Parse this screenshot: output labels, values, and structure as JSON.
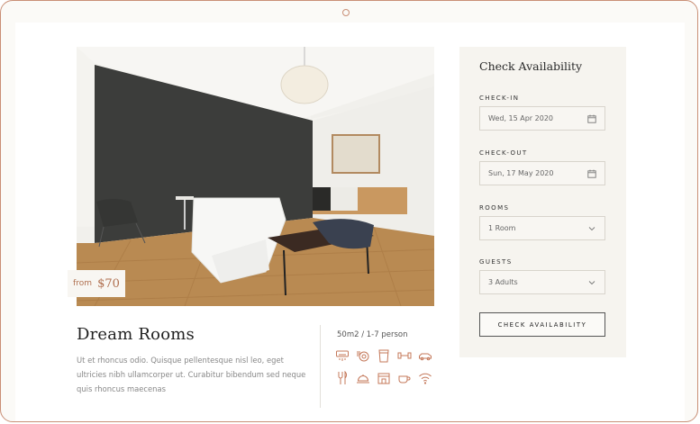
{
  "room": {
    "price_prefix": "from",
    "price": "$70",
    "title": "Dream Rooms",
    "description": "Ut et rhoncus odio. Quisque pellentesque nisl leo, eget ultricies nibh ullamcorper ut. Curabitur bibendum sed neque quis rhoncus maecenas",
    "capacity": "50m2 / 1-7 person",
    "amenity_icons": [
      "air-conditioner-icon",
      "breakfast-icon",
      "laundry-icon",
      "gym-icon",
      "car-icon",
      "restaurant-icon",
      "room-service-icon",
      "store-icon",
      "coffee-icon",
      "wifi-icon"
    ]
  },
  "booking": {
    "title": "Check Availability",
    "checkin_label": "CHECK-IN",
    "checkin_value": "Wed, 15 Apr 2020",
    "checkout_label": "CHECK-OUT",
    "checkout_value": "Sun, 17 May 2020",
    "rooms_label": "ROOMS",
    "rooms_value": "1 Room",
    "guests_label": "GUESTS",
    "guests_value": "3 Adults",
    "button_label": "CHECK AVAILABILITY"
  },
  "colors": {
    "accent": "#b07050",
    "icon": "#c4785a",
    "frame": "#c98f76",
    "panel_bg": "#f6f4ef"
  }
}
